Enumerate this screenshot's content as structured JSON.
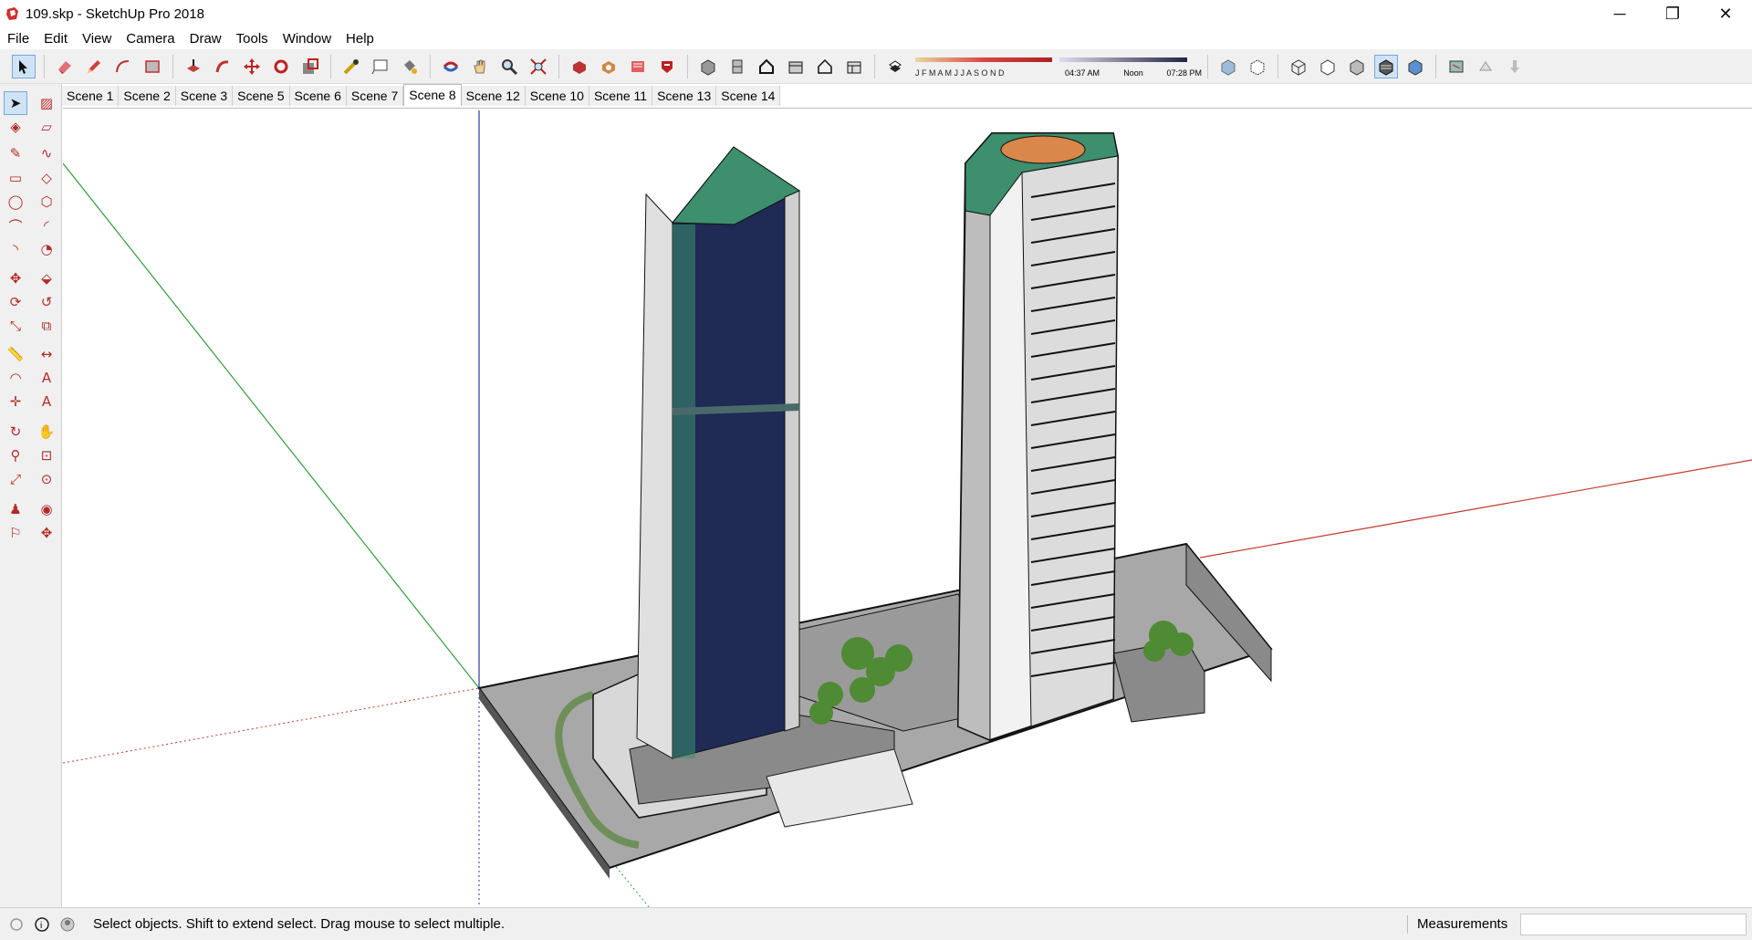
{
  "window": {
    "title": "109.skp - SketchUp Pro 2018",
    "minimize": "─",
    "maximize": "❐",
    "close": "✕"
  },
  "menu": [
    "File",
    "Edit",
    "View",
    "Camera",
    "Draw",
    "Tools",
    "Window",
    "Help"
  ],
  "toolbar": {
    "icons": [
      "select-icon",
      "eraser-icon",
      "pencil-icon",
      "arc-icon",
      "rectangle-icon",
      "push-pull-icon",
      "follow-me-icon",
      "move-icon",
      "rotate-icon",
      "scale-icon",
      "tape-measure-icon",
      "text-icon",
      "paint-bucket-icon",
      "orbit-icon",
      "pan-icon",
      "zoom-icon",
      "zoom-extents-icon",
      "3d-warehouse-icon",
      "extension-warehouse-icon",
      "layout-icon",
      "extension-manager-icon",
      "iso-view-icon",
      "top-view-icon",
      "front-view-icon",
      "right-view-icon",
      "back-view-icon",
      "left-view-icon",
      "shadows-icon"
    ],
    "shadow_months": "J F M A M J J A S O N D",
    "shadow_time_start": "04:37 AM",
    "shadow_time_noon": "Noon",
    "shadow_time_end": "07:28 PM",
    "style_icons": [
      "xray-icon",
      "back-edges-icon",
      "wireframe-icon",
      "hidden-line-icon",
      "shaded-icon",
      "shaded-textures-icon",
      "monochrome-icon",
      "section-plane-icon",
      "section-cut-icon",
      "section-fill-icon"
    ]
  },
  "scenes": [
    "Scene 1",
    "Scene 2",
    "Scene 3",
    "Scene 5",
    "Scene 6",
    "Scene 7",
    "Scene 8",
    "Scene 12",
    "Scene 10",
    "Scene 11",
    "Scene 13",
    "Scene 14"
  ],
  "active_scene": "Scene 8",
  "palette": [
    [
      "select-icon",
      "component-icon"
    ],
    [
      "paint-bucket-icon",
      "eraser-icon"
    ],
    [
      "pencil-icon",
      "freehand-icon"
    ],
    [
      "rectangle-icon",
      "rotated-rectangle-icon"
    ],
    [
      "circle-icon",
      "polygon-icon"
    ],
    [
      "arc-icon",
      "two-point-arc-icon"
    ],
    [
      "three-point-arc-icon",
      "pie-icon"
    ],
    [
      "move-icon",
      "push-pull-icon"
    ],
    [
      "rotate-icon",
      "follow-me-icon"
    ],
    [
      "scale-icon",
      "offset-icon"
    ],
    [
      "tape-measure-icon",
      "dimension-icon"
    ],
    [
      "protractor-icon",
      "text-icon"
    ],
    [
      "axes-icon",
      "3d-text-icon"
    ],
    [
      "orbit-icon",
      "pan-icon"
    ],
    [
      "zoom-icon",
      "zoom-window-icon"
    ],
    [
      "zoom-extents-icon",
      "previous-view-icon"
    ],
    [
      "position-camera-icon",
      "look-around-icon"
    ],
    [
      "walk-icon",
      "section-plane-icon"
    ]
  ],
  "status": {
    "text": "Select objects. Shift to extend select. Drag mouse to select multiple.",
    "measurements_label": "Measurements",
    "measurements_value": ""
  },
  "colors": {
    "axis_red": "#c0392b",
    "axis_green": "#2e9d3a",
    "axis_blue": "#2b3aa8",
    "tower_glass": "#1f2a55",
    "tower_green": "#3d8f6e",
    "roof_orange": "#d9874a",
    "podium": "#9a9a9a",
    "tree": "#4f8a34"
  }
}
